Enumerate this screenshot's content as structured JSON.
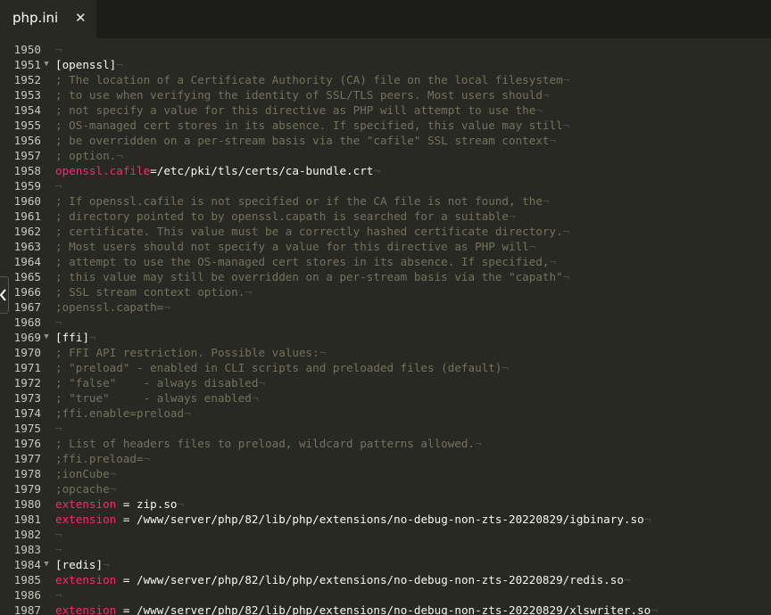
{
  "tab": {
    "title": "php.ini",
    "close_icon": "close-icon"
  },
  "eol_mark": "¬",
  "lines": [
    {
      "n": "1950",
      "kind": "blank",
      "fold": false,
      "text": ""
    },
    {
      "n": "1951",
      "kind": "section",
      "fold": true,
      "text": "[openssl]"
    },
    {
      "n": "1952",
      "kind": "comment",
      "fold": false,
      "text": "; The location of a Certificate Authority (CA) file on the local filesystem"
    },
    {
      "n": "1953",
      "kind": "comment",
      "fold": false,
      "text": "; to use when verifying the identity of SSL/TLS peers. Most users should"
    },
    {
      "n": "1954",
      "kind": "comment",
      "fold": false,
      "text": "; not specify a value for this directive as PHP will attempt to use the"
    },
    {
      "n": "1955",
      "kind": "comment",
      "fold": false,
      "text": "; OS-managed cert stores in its absence. If specified, this value may still"
    },
    {
      "n": "1956",
      "kind": "comment",
      "fold": false,
      "text": "; be overridden on a per-stream basis via the \"cafile\" SSL stream context"
    },
    {
      "n": "1957",
      "kind": "comment",
      "fold": false,
      "text": "; option."
    },
    {
      "n": "1958",
      "kind": "setting",
      "fold": false,
      "key": "openssl.cafile",
      "sep": "=",
      "value": "/etc/pki/tls/certs/ca-bundle.crt"
    },
    {
      "n": "1959",
      "kind": "blank",
      "fold": false,
      "text": ""
    },
    {
      "n": "1960",
      "kind": "comment",
      "fold": false,
      "text": "; If openssl.cafile is not specified or if the CA file is not found, the"
    },
    {
      "n": "1961",
      "kind": "comment",
      "fold": false,
      "text": "; directory pointed to by openssl.capath is searched for a suitable"
    },
    {
      "n": "1962",
      "kind": "comment",
      "fold": false,
      "text": "; certificate. This value must be a correctly hashed certificate directory."
    },
    {
      "n": "1963",
      "kind": "comment",
      "fold": false,
      "text": "; Most users should not specify a value for this directive as PHP will"
    },
    {
      "n": "1964",
      "kind": "comment",
      "fold": false,
      "text": "; attempt to use the OS-managed cert stores in its absence. If specified,"
    },
    {
      "n": "1965",
      "kind": "comment",
      "fold": false,
      "text": "; this value may still be overridden on a per-stream basis via the \"capath\""
    },
    {
      "n": "1966",
      "kind": "comment",
      "fold": false,
      "text": "; SSL stream context option."
    },
    {
      "n": "1967",
      "kind": "comment",
      "fold": false,
      "text": ";openssl.capath="
    },
    {
      "n": "1968",
      "kind": "blank",
      "fold": false,
      "text": ""
    },
    {
      "n": "1969",
      "kind": "section",
      "fold": true,
      "text": "[ffi]"
    },
    {
      "n": "1970",
      "kind": "comment",
      "fold": false,
      "text": "; FFI API restriction. Possible values:"
    },
    {
      "n": "1971",
      "kind": "comment",
      "fold": false,
      "text": "; \"preload\" - enabled in CLI scripts and preloaded files (default)"
    },
    {
      "n": "1972",
      "kind": "comment",
      "fold": false,
      "text": "; \"false\"    - always disabled"
    },
    {
      "n": "1973",
      "kind": "comment",
      "fold": false,
      "text": "; \"true\"     - always enabled"
    },
    {
      "n": "1974",
      "kind": "comment",
      "fold": false,
      "text": ";ffi.enable=preload"
    },
    {
      "n": "1975",
      "kind": "blank",
      "fold": false,
      "text": ""
    },
    {
      "n": "1976",
      "kind": "comment",
      "fold": false,
      "text": "; List of headers files to preload, wildcard patterns allowed."
    },
    {
      "n": "1977",
      "kind": "comment",
      "fold": false,
      "text": ";ffi.preload="
    },
    {
      "n": "1978",
      "kind": "comment",
      "fold": false,
      "text": ";ionCube"
    },
    {
      "n": "1979",
      "kind": "comment",
      "fold": false,
      "text": ";opcache"
    },
    {
      "n": "1980",
      "kind": "setting",
      "fold": false,
      "key": "extension",
      "sep": " = ",
      "value": "zip.so"
    },
    {
      "n": "1981",
      "kind": "setting",
      "fold": false,
      "key": "extension",
      "sep": " = ",
      "value": "/www/server/php/82/lib/php/extensions/no-debug-non-zts-20220829/igbinary.so"
    },
    {
      "n": "1982",
      "kind": "blank",
      "fold": false,
      "text": ""
    },
    {
      "n": "1983",
      "kind": "blank",
      "fold": false,
      "text": ""
    },
    {
      "n": "1984",
      "kind": "section",
      "fold": true,
      "text": "[redis]"
    },
    {
      "n": "1985",
      "kind": "setting",
      "fold": false,
      "key": "extension",
      "sep": " = ",
      "value": "/www/server/php/82/lib/php/extensions/no-debug-non-zts-20220829/redis.so"
    },
    {
      "n": "1986",
      "kind": "blank",
      "fold": false,
      "text": ""
    },
    {
      "n": "1987",
      "kind": "setting",
      "fold": false,
      "key": "extension",
      "sep": " = ",
      "value": "/www/server/php/82/lib/php/extensions/no-debug-non-zts-20220829/xlswriter.so"
    }
  ],
  "colors": {
    "background": "#282923",
    "comment": "#75715e",
    "key": "#f92672",
    "text": "#f8f8f2",
    "line_number": "#c8c8bd"
  },
  "side_handle_icon": "chevron-left-icon"
}
